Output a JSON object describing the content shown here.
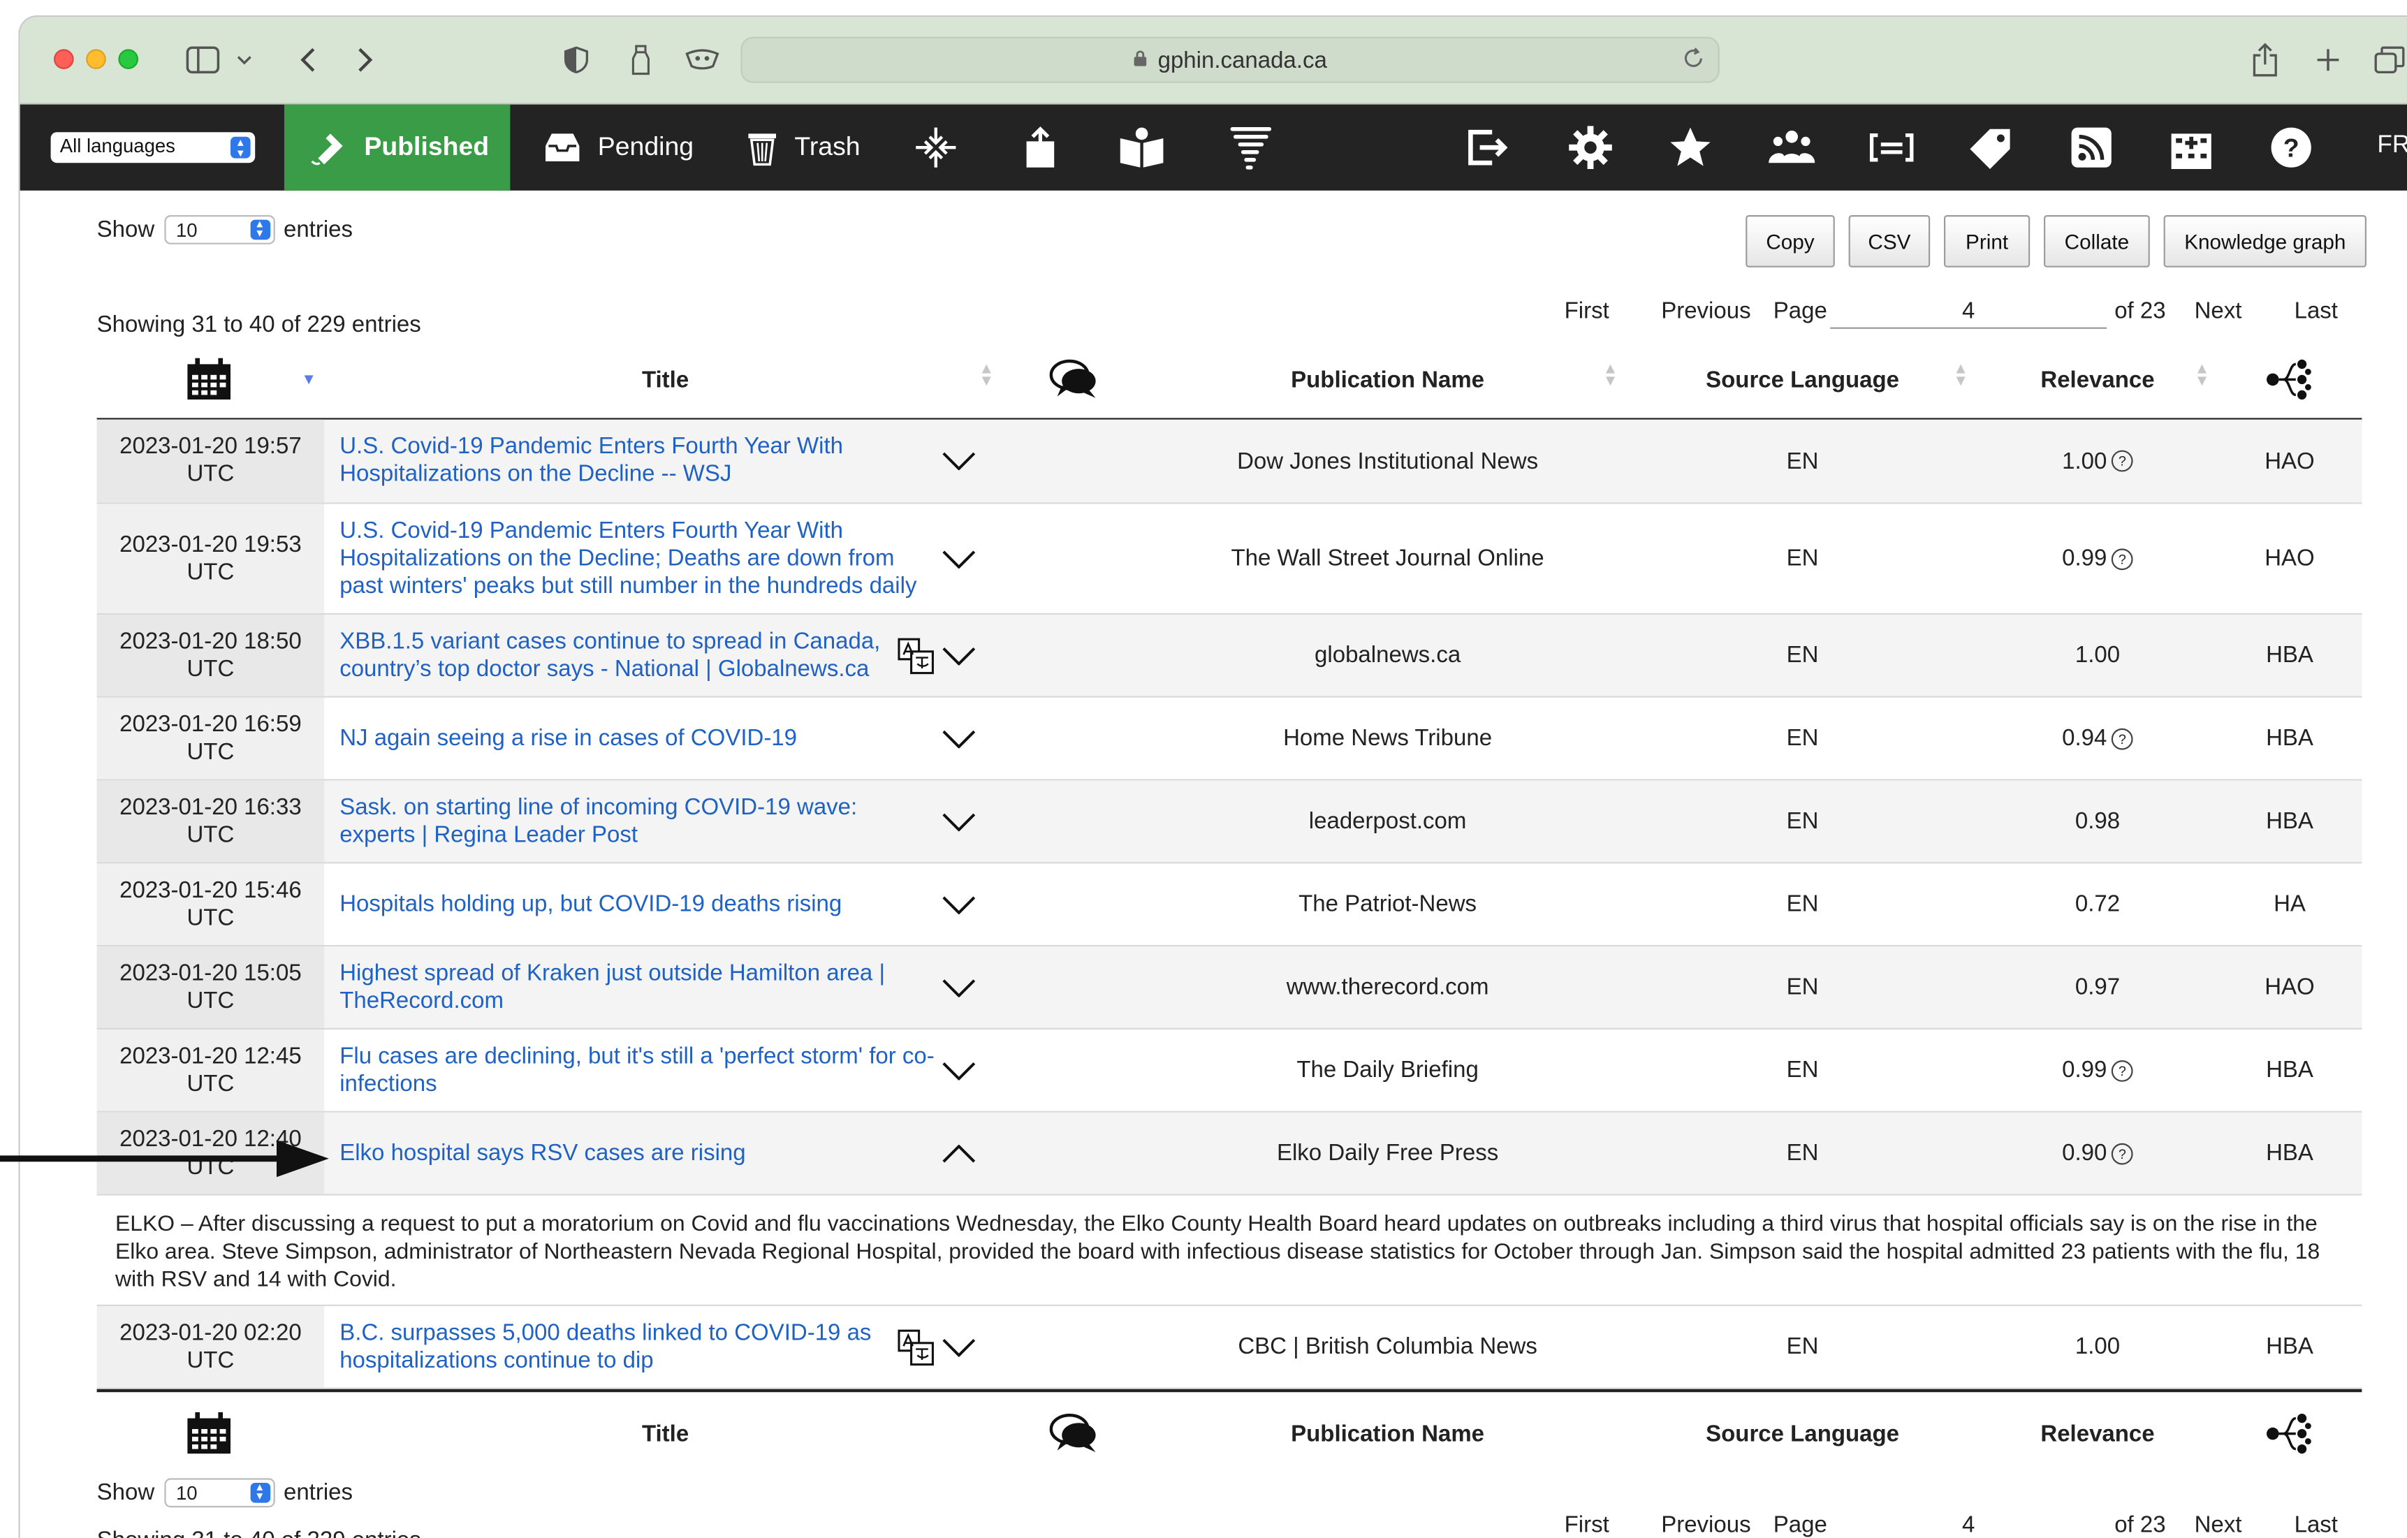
{
  "browser": {
    "url": "gphin.canada.ca"
  },
  "nav": {
    "language_select": "All languages",
    "published": "Published",
    "pending": "Pending",
    "trash": "Trash",
    "fr": "FR"
  },
  "controls": {
    "show_label": "Show",
    "entries_value": "10",
    "entries_label": "entries",
    "buttons": [
      "Copy",
      "CSV",
      "Print",
      "Collate",
      "Knowledge graph"
    ],
    "info": "Showing 31 to 40 of 229 entries",
    "pager": {
      "first": "First",
      "previous": "Previous",
      "page_label": "Page",
      "page_value": "4",
      "of": "of 23",
      "next": "Next",
      "last": "Last"
    }
  },
  "table": {
    "headers": {
      "title": "Title",
      "publication": "Publication Name",
      "source_language": "Source Language",
      "relevance": "Relevance"
    },
    "rows": [
      {
        "date": "2023-01-20 19:57",
        "tz": "UTC",
        "title": "U.S. Covid-19 Pandemic Enters Fourth Year With Hospitalizations on the Decline -- WSJ",
        "publication": "Dow Jones Institutional News",
        "lang": "EN",
        "relevance": "1.00",
        "code": "HAO"
      },
      {
        "date": "2023-01-20 19:53",
        "tz": "UTC",
        "title": "U.S. Covid-19 Pandemic Enters Fourth Year With Hospitalizations on the Decline; Deaths are down from past winters' peaks but still number in the hundreds daily",
        "publication": "The Wall Street Journal Online",
        "lang": "EN",
        "relevance": "0.99",
        "code": "HAO"
      },
      {
        "date": "2023-01-20 18:50",
        "tz": "UTC",
        "title": "XBB.1.5 variant cases continue to spread in Canada, country’s top doctor says - National | Globalnews.ca",
        "publication": "globalnews.ca",
        "lang": "EN",
        "relevance": "1.00",
        "code": "HBA"
      },
      {
        "date": "2023-01-20 16:59",
        "tz": "UTC",
        "title": "NJ again seeing a rise in cases of COVID-19",
        "publication": "Home News Tribune",
        "lang": "EN",
        "relevance": "0.94",
        "code": "HBA"
      },
      {
        "date": "2023-01-20 16:33",
        "tz": "UTC",
        "title": "Sask. on starting line of incoming COVID-19 wave: experts | Regina Leader Post",
        "publication": "leaderpost.com",
        "lang": "EN",
        "relevance": "0.98",
        "code": "HBA"
      },
      {
        "date": "2023-01-20 15:46",
        "tz": "UTC",
        "title": "Hospitals holding up, but COVID-19 deaths rising",
        "publication": "The Patriot-News",
        "lang": "EN",
        "relevance": "0.72",
        "code": "HA"
      },
      {
        "date": "2023-01-20 15:05",
        "tz": "UTC",
        "title": "Highest spread of Kraken just outside Hamilton area | TheRecord.com",
        "publication": "www.therecord.com",
        "lang": "EN",
        "relevance": "0.97",
        "code": "HAO"
      },
      {
        "date": "2023-01-20 12:45",
        "tz": "UTC",
        "title": "Flu cases are declining, but it's still a 'perfect storm' for co-infections",
        "publication": "The Daily Briefing",
        "lang": "EN",
        "relevance": "0.99",
        "code": "HBA"
      },
      {
        "date": "2023-01-20 12:40",
        "tz": "UTC",
        "title": "Elko hospital says RSV cases are rising",
        "publication": "Elko Daily Free Press",
        "lang": "EN",
        "relevance": "0.90",
        "code": "HBA"
      },
      {
        "date": "2023-01-20 02:20",
        "tz": "UTC",
        "title": "B.C. surpasses 5,000 deaths linked to COVID-19 as hospitalizations continue to dip",
        "publication": "CBC | British Columbia News",
        "lang": "EN",
        "relevance": "1.00",
        "code": "HBA"
      }
    ],
    "expanded_summary": "ELKO – After discussing a request to put a moratorium on Covid and flu vaccinations Wednesday, the Elko County Health Board heard updates on outbreaks including a third virus that hospital officials say is on the rise in the Elko area. Steve Simpson, administrator of Northeastern Nevada Regional Hospital, provided the board with infectious disease statistics for October through Jan. Simpson said the hospital admitted 23 patients with the flu, 18 with RSV and 14 with Covid."
  },
  "colors": {
    "nav_bg": "#232323",
    "published_active": "#3b9c47",
    "link": "#1f62c4",
    "chrome_bg": "#d8e5d4"
  }
}
